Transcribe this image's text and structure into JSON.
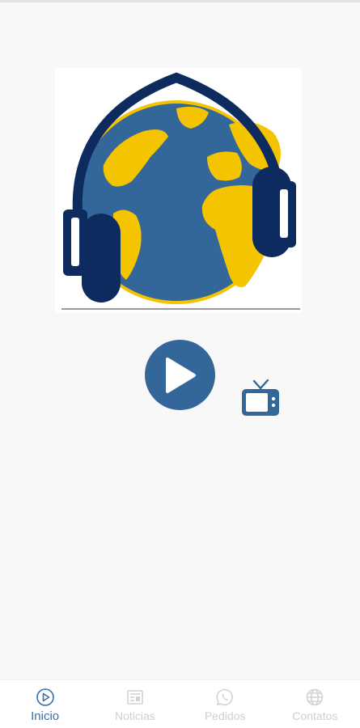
{
  "app": {
    "accent_color": "#336699",
    "logo_icon": "globe-headphones-logo"
  },
  "player": {
    "play_icon": "play-icon",
    "tv_icon": "tv-icon"
  },
  "bottom_nav": {
    "items": [
      {
        "label": "Inicio",
        "icon": "play-circle-icon",
        "active": true
      },
      {
        "label": "Noticias",
        "icon": "newspaper-icon",
        "active": false
      },
      {
        "label": "Pedidos",
        "icon": "whatsapp-icon",
        "active": false
      },
      {
        "label": "Contatos",
        "icon": "globe-icon",
        "active": false
      }
    ]
  }
}
